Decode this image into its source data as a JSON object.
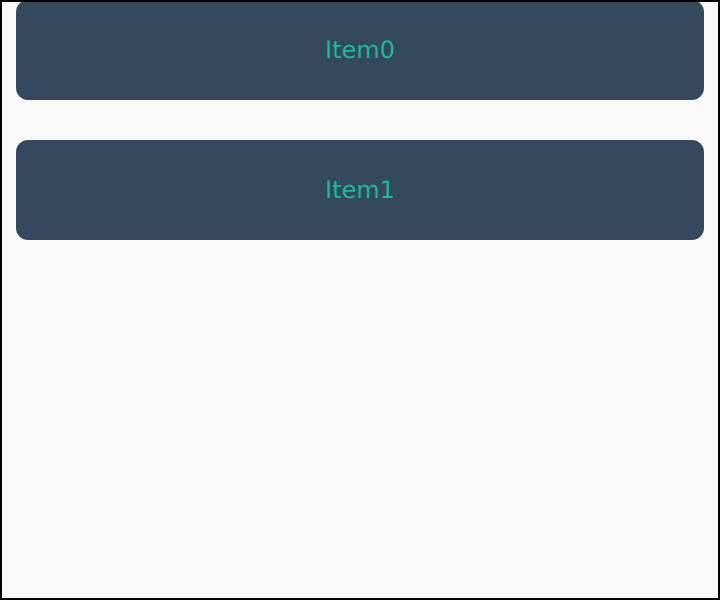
{
  "list": {
    "items": [
      {
        "label": "Item0"
      },
      {
        "label": "Item1"
      }
    ]
  },
  "colors": {
    "background": "#f9f9f9",
    "item_background": "#34495e",
    "item_text": "#1abc9c",
    "border": "#000000"
  }
}
